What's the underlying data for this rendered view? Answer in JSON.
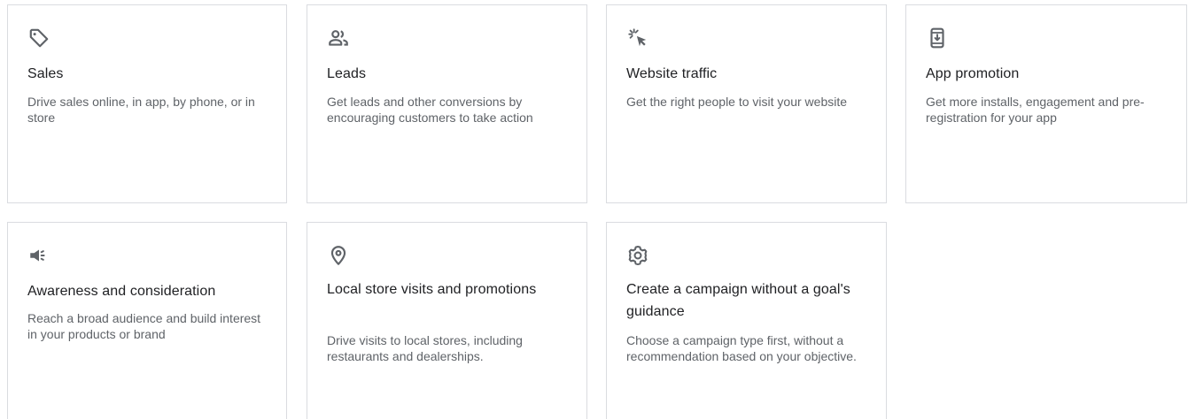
{
  "goals": [
    {
      "id": "sales",
      "icon": "tag-icon",
      "title": "Sales",
      "description": "Drive sales online, in app, by phone, or in store"
    },
    {
      "id": "leads",
      "icon": "people-icon",
      "title": "Leads",
      "description": "Get leads and other conversions by encouraging customers to take action"
    },
    {
      "id": "traffic",
      "icon": "cursor-click-icon",
      "title": "Website traffic",
      "description": "Get the right people to visit your website"
    },
    {
      "id": "app",
      "icon": "phone-download-icon",
      "title": "App promotion",
      "description": "Get more installs, engagement and pre-registration for your app"
    },
    {
      "id": "awareness",
      "icon": "megaphone-icon",
      "title": "Awareness and consideration",
      "description": "Reach a broad audience and build interest in your products or brand"
    },
    {
      "id": "local",
      "icon": "location-pin-icon",
      "title": "Local store visits and promotions",
      "description": "Drive visits to local stores, including restaurants and dealerships."
    },
    {
      "id": "nogoal",
      "icon": "gear-icon",
      "title": "Create a campaign without a goal's guidance",
      "description": "Choose a campaign type first, without a recommendation based on your objective."
    }
  ]
}
